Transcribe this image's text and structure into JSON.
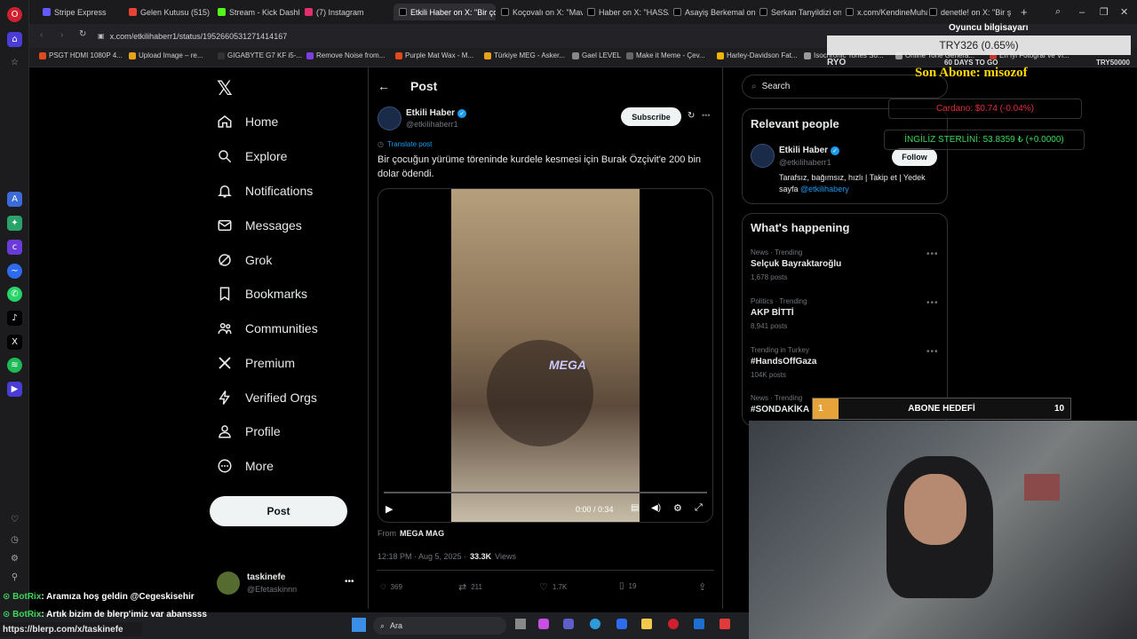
{
  "colors": {
    "x_blue": "#1d9bf0",
    "background": "#000000",
    "muted": "#71767b",
    "text": "#e7e9ea",
    "green_overlay": "#3ed65b",
    "red_overlay": "#e0303a",
    "yellow_overlay": "#ffd600"
  },
  "browser": {
    "tabs": [
      "Stripe Express",
      "Gelen Kutusu (515) -",
      "Stream - Kick Dashbo",
      "(7) Instagram",
      "Etkili Haber on X: \"Bir ço",
      "Koçovalı on X: \"Mavi",
      "Haber on X: \"HASSAS",
      "Asayiş Berkemal on X",
      "Serkan Tanyildizi on X",
      "x.com/KendineMuhab",
      "denetle! on X: \"Bir şal"
    ],
    "url": "x.com/etkilihaberr1/status/1952660531271414167",
    "bookmarks": [
      "PSGT HDMI 1080P 4...",
      "Upload Image – re...",
      "GIGABYTE G7 KF i5-...",
      "Remove Noise from...",
      "Purple Mat Wax - M...",
      "Türkiye MEG - Asker...",
      "Gael LEVEL",
      "Make it Meme - Çev...",
      "Harley-Davidson Fat...",
      "Isochronic Tones So...",
      "Online Tone Genera...",
      "En İyi Fotoğraf ve Vi..."
    ]
  },
  "nav": {
    "items": [
      {
        "label": "Home",
        "icon": "home-icon"
      },
      {
        "label": "Explore",
        "icon": "search-icon"
      },
      {
        "label": "Notifications",
        "icon": "bell-icon"
      },
      {
        "label": "Messages",
        "icon": "mail-icon"
      },
      {
        "label": "Grok",
        "icon": "grok-icon"
      },
      {
        "label": "Bookmarks",
        "icon": "bookmark-icon"
      },
      {
        "label": "Communities",
        "icon": "people-icon"
      },
      {
        "label": "Premium",
        "icon": "x-icon"
      },
      {
        "label": "Verified Orgs",
        "icon": "lightning-icon"
      },
      {
        "label": "Profile",
        "icon": "person-icon"
      },
      {
        "label": "More",
        "icon": "more-circle-icon"
      }
    ],
    "post_label": "Post",
    "account": {
      "name": "taskinefe",
      "handle": "@Efetaskinnn"
    }
  },
  "post": {
    "header_title": "Post",
    "author_name": "Etkili Haber",
    "author_handle": "@etkiIihaberr1",
    "subscribe_label": "Subscribe",
    "translate_label": "Translate post",
    "text": "Bir çocuğun yürüme töreninde kurdele kesmesi için Burak Özçivit'e 200 bin dolar ödendi.",
    "video_watermark": "MEGA",
    "video_time": "0:00 / 0:34",
    "from_prefix": "From",
    "from_source": "MEGA MAG",
    "timestamp": "12:18 PM · Aug 5, 2025 ·",
    "views_count": "33.3K",
    "views_label": "Views",
    "replies": "369",
    "reposts": "211",
    "likes": "1.7K",
    "bookmarks": "19"
  },
  "sidebar": {
    "search_placeholder": "Search",
    "relevant_title": "Relevant people",
    "person": {
      "name": "Etkili Haber",
      "handle": "@etkiIihaberr1",
      "follow_label": "Follow",
      "bio": "Tarafsız, bağımsız, hızlı | Takip et | Yedek sayfa",
      "bio_link": "@etkilihabery"
    },
    "happening_title": "What's happening",
    "trends": [
      {
        "meta": "News · Trending",
        "name": "Selçuk Bayraktaroğlu",
        "posts": "1,678 posts"
      },
      {
        "meta": "Politics · Trending",
        "name": "AKP BİTTİ",
        "posts": "8,941 posts"
      },
      {
        "meta": "Trending in Turkey",
        "name": "#HandsOffGaza",
        "posts": "104K posts"
      },
      {
        "meta": "News · Trending",
        "name": "#SONDAKİKA",
        "posts": ""
      }
    ]
  },
  "overlays": {
    "pc_label": "Oyuncu bilgisayarı",
    "try_value": "TRY326 (0.65%)",
    "ryo": "RYO",
    "days_to_go": "60 DAYS TO GO",
    "try_goal": "TRY50000",
    "son_abone": "Son Abone: misozof",
    "cardano": "Cardano: $0.74 (-0.04%)",
    "sterlin": "İNGİLİZ STERLİNİ: 53.8359 ₺ (+0.0000)",
    "goal_current": "1",
    "goal_label": "ABONE HEDEFİ",
    "goal_target": "10",
    "goal_progress": 0.1
  },
  "chat": [
    {
      "user": "BotRix",
      "message": ": Aramıza hoş geldin @Cegeskisehir"
    },
    {
      "user": "BotRix",
      "message": ": Artık bizim de blerp'imiz var abanssss"
    }
  ],
  "status_url": "https://blerp.com/x/taskinefe",
  "taskbar": {
    "search_label": "Ara"
  }
}
